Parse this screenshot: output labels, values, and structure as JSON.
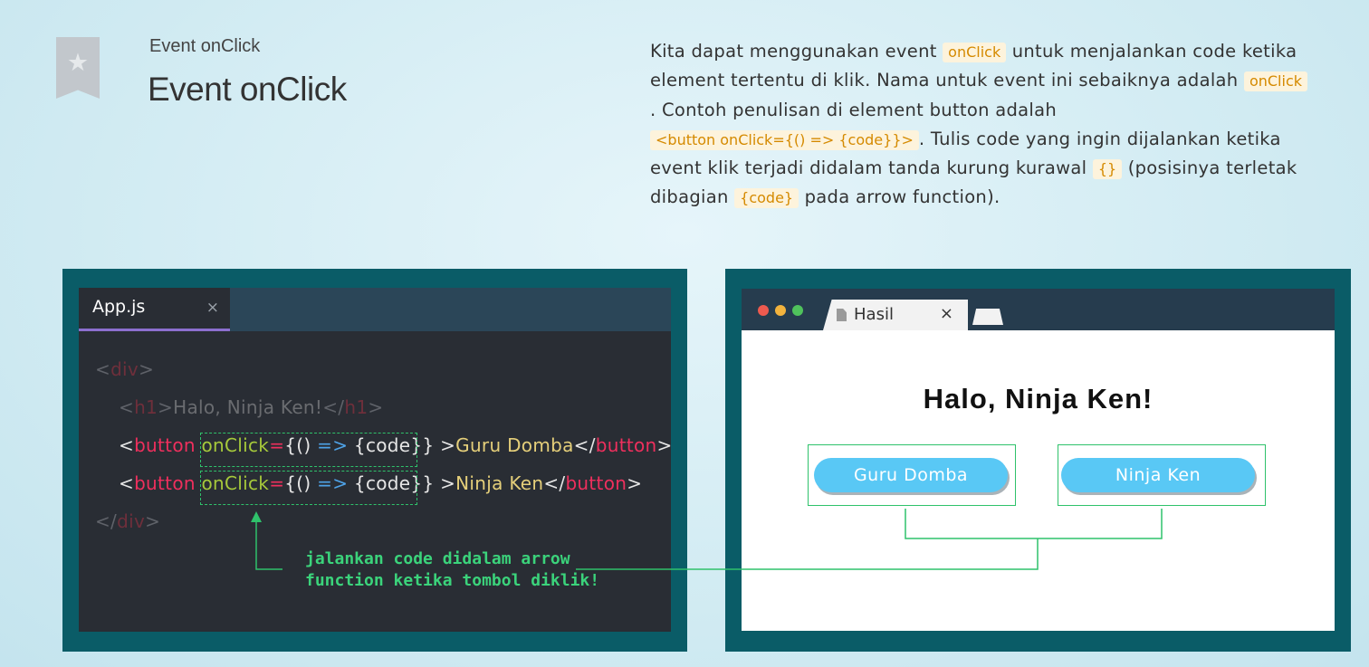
{
  "header": {
    "eyebrow": "Event onClick",
    "title": "Event onClick",
    "bookmark_icon": "star-icon",
    "bookmark_glyph": "★"
  },
  "description": {
    "lines": [
      [
        {
          "text": "Kita dapat menggunakan event "
        },
        {
          "text": "onClick",
          "code": true
        },
        {
          "text": " untuk menjalankan code ketika"
        }
      ],
      [
        {
          "text": "element tertentu di klik. Nama untuk event ini sebaiknya adalah "
        },
        {
          "text": "onClick",
          "code": true
        }
      ],
      [
        {
          "text": ". Contoh penulisan di element button adalah"
        }
      ],
      [
        {
          "text": "<button onClick={() => {code}}>",
          "code": true
        },
        {
          "text": ". Tulis code yang ingin dijalankan ketika"
        }
      ],
      [
        {
          "text": "event klik terjadi didalam tanda kurung kurawal "
        },
        {
          "text": "{}",
          "code": true
        },
        {
          "text": " (posisinya terletak"
        }
      ],
      [
        {
          "text": "dibagian "
        },
        {
          "text": "{code}",
          "code": true
        },
        {
          "text": " pada arrow function)."
        }
      ]
    ]
  },
  "editor": {
    "tab_name": "App.js",
    "tab_close": "×",
    "lines": [
      [
        {
          "t": "<",
          "c": "dim"
        },
        {
          "t": "div",
          "c": "dim-tag"
        },
        {
          "t": ">",
          "c": "dim"
        }
      ],
      [
        {
          "t": "<",
          "c": "dim"
        },
        {
          "t": "h1",
          "c": "dim-tag"
        },
        {
          "t": ">",
          "c": "dim"
        },
        {
          "t": "Halo, Ninja Ken!",
          "c": "dim-text"
        },
        {
          "t": "</",
          "c": "dim"
        },
        {
          "t": "h1",
          "c": "dim-tag"
        },
        {
          "t": ">",
          "c": "dim"
        }
      ],
      [
        {
          "t": "<",
          "c": "pun"
        },
        {
          "t": "button",
          "c": "tag"
        },
        {
          "t": " ",
          "c": "pun"
        },
        {
          "t": "onClick",
          "c": "attr"
        },
        {
          "t": "=",
          "c": "tag"
        },
        {
          "t": "{() ",
          "c": "pun"
        },
        {
          "t": "=>",
          "c": "arrow-op"
        },
        {
          "t": " {code}}",
          "c": "pun"
        },
        {
          "t": " >",
          "c": "pun"
        },
        {
          "t": "Guru Domba",
          "c": "str"
        },
        {
          "t": "</",
          "c": "pun"
        },
        {
          "t": "button",
          "c": "tag"
        },
        {
          "t": ">",
          "c": "pun"
        }
      ],
      [
        {
          "t": "<",
          "c": "pun"
        },
        {
          "t": "button",
          "c": "tag"
        },
        {
          "t": " ",
          "c": "pun"
        },
        {
          "t": "onClick",
          "c": "attr"
        },
        {
          "t": "=",
          "c": "tag"
        },
        {
          "t": "{() ",
          "c": "pun"
        },
        {
          "t": "=>",
          "c": "arrow-op"
        },
        {
          "t": " {code}}",
          "c": "pun"
        },
        {
          "t": " >",
          "c": "pun"
        },
        {
          "t": "Ninja Ken",
          "c": "str"
        },
        {
          "t": "</",
          "c": "pun"
        },
        {
          "t": "button",
          "c": "tag"
        },
        {
          "t": ">",
          "c": "pun"
        }
      ],
      [
        {
          "t": "</",
          "c": "dim"
        },
        {
          "t": "div",
          "c": "dim-tag"
        },
        {
          "t": ">",
          "c": "dim"
        }
      ]
    ],
    "note_line1": "jalankan code didalam arrow",
    "note_line2": "function ketika tombol diklik!"
  },
  "browser": {
    "tab_name": "Hasil",
    "tab_close": "×",
    "heading": "Halo, Ninja Ken!",
    "buttons": [
      "Guru Domba",
      "Ninja Ken"
    ]
  },
  "colors": {
    "panel": "#0a5c67",
    "accent_green": "#2fc26b",
    "chip_text": "#d58a00",
    "chip_bg": "#fdf3dc",
    "button_blue": "#59c8f5",
    "dots": [
      "#ed5a4f",
      "#f2b33d",
      "#4fc25c"
    ]
  }
}
